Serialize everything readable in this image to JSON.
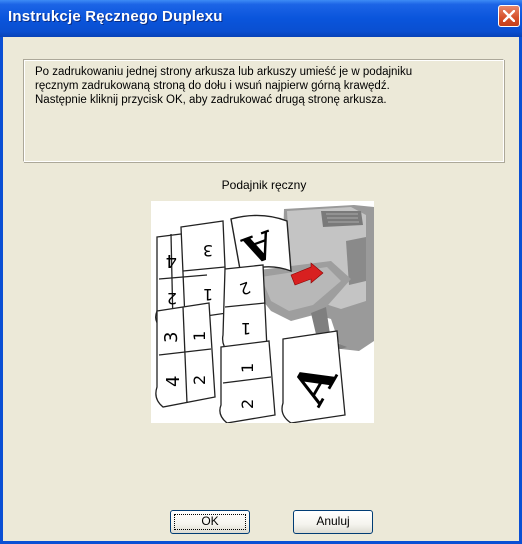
{
  "window": {
    "title": "Instrukcje Ręcznego Duplexu",
    "close_icon": "close-icon"
  },
  "message": {
    "lines": [
      "Po zadrukowaniu jednej strony arkusza lub arkuszy umieść je w podajniku",
      "ręcznym zadrukowaną stroną do dołu i wsuń najpierw górną krawędź.",
      "Następnie kliknij przycisk OK, aby zadrukować drugą stronę arkusza."
    ]
  },
  "illustration": {
    "caption": "Podajnik ręczny",
    "page_letter": "A",
    "sheet_numbers": [
      "4",
      "3",
      "2",
      "1",
      "2",
      "1",
      "3",
      "1",
      "4",
      "2",
      "1",
      "2"
    ]
  },
  "buttons": {
    "ok_label": "OK",
    "cancel_label": "Anuluj"
  },
  "colors": {
    "title_bar": "#0a55dc",
    "window_bg": "#ece9d8",
    "close_button": "#d6502a"
  }
}
